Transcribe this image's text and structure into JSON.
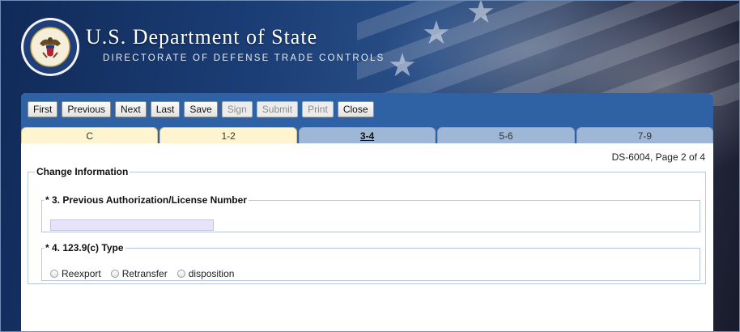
{
  "header": {
    "title": "U.S. Department of State",
    "subtitle": "DIRECTORATE OF DEFENSE TRADE CONTROLS",
    "seal_icon": "department-of-state-seal"
  },
  "toolbar": {
    "buttons": [
      {
        "label": "First",
        "enabled": true
      },
      {
        "label": "Previous",
        "enabled": true
      },
      {
        "label": "Next",
        "enabled": true
      },
      {
        "label": "Last",
        "enabled": true
      },
      {
        "label": "Save",
        "enabled": true
      },
      {
        "label": "Sign",
        "enabled": false
      },
      {
        "label": "Submit",
        "enabled": false
      },
      {
        "label": "Print",
        "enabled": false
      },
      {
        "label": "Close",
        "enabled": true
      }
    ]
  },
  "tabs": [
    {
      "label": "C",
      "state": "done"
    },
    {
      "label": "1-2",
      "state": "done"
    },
    {
      "label": "3-4",
      "state": "active"
    },
    {
      "label": "5-6",
      "state": "todo"
    },
    {
      "label": "7-9",
      "state": "todo"
    }
  ],
  "form": {
    "page_label": "DS-6004, Page 2 of 4",
    "section_title": "Change Information",
    "q3": {
      "legend": "* 3. Previous Authorization/License Number",
      "value": ""
    },
    "q4": {
      "legend": "* 4. 123.9(c) Type",
      "options": [
        "Reexport",
        "Retransfer",
        "disposition"
      ]
    }
  },
  "colors": {
    "toolbar_blue": "#2f62a5",
    "tab_done": "#fff4d0",
    "tab_todo": "#9fb7d7",
    "input_bg": "#e6e3fb"
  }
}
